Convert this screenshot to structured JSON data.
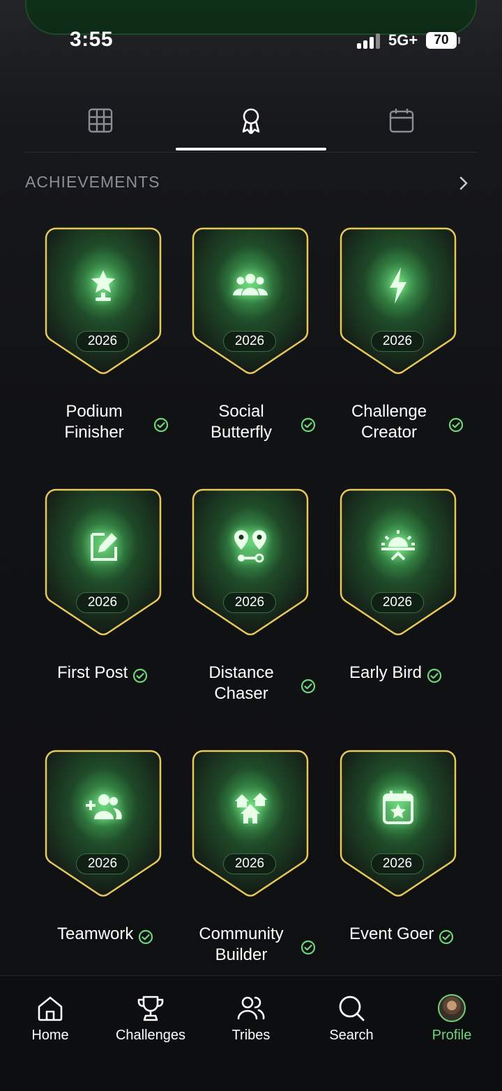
{
  "status_bar": {
    "time": "3:55",
    "network": "5G+",
    "battery": "70"
  },
  "tabs": [
    {
      "icon": "grid-icon"
    },
    {
      "icon": "ribbon-award-icon",
      "selected": true
    },
    {
      "icon": "calendar-icon"
    }
  ],
  "section": {
    "title": "ACHIEVEMENTS",
    "arrow_icon": "chevron-right-icon"
  },
  "achievements": [
    {
      "name": "Podium Finisher",
      "line1": "Podium",
      "line2": "Finisher",
      "year": "2026",
      "icon": "trophy-star-icon",
      "completed": true
    },
    {
      "name": "Social Butterfly",
      "line1": "Social",
      "line2": "Butterfly",
      "year": "2026",
      "icon": "group-icon",
      "completed": true
    },
    {
      "name": "Challenge Creator",
      "line1": "Challenge",
      "line2": "Creator",
      "year": "2026",
      "icon": "lightning-icon",
      "completed": true
    },
    {
      "name": "First Post",
      "line1": "First Post",
      "line2": "",
      "year": "2026",
      "icon": "edit-icon",
      "completed": true
    },
    {
      "name": "Distance Chaser",
      "line1": "Distance",
      "line2": "Chaser",
      "year": "2026",
      "icon": "route-pins-icon",
      "completed": true
    },
    {
      "name": "Early Bird",
      "line1": "Early Bird",
      "line2": "",
      "year": "2026",
      "icon": "sunrise-icon",
      "completed": true
    },
    {
      "name": "Teamwork",
      "line1": "Teamwork",
      "line2": "",
      "year": "2026",
      "icon": "add-group-icon",
      "completed": true
    },
    {
      "name": "Community Builder",
      "line1": "Community",
      "line2": "Builder",
      "year": "2026",
      "icon": "houses-icon",
      "completed": true
    },
    {
      "name": "Event Goer",
      "line1": "Event Goer",
      "line2": "",
      "year": "2026",
      "icon": "calendar-star-icon",
      "completed": true
    }
  ],
  "bottom_nav": [
    {
      "label": "Home",
      "icon": "home-icon"
    },
    {
      "label": "Challenges",
      "icon": "trophy-icon"
    },
    {
      "label": "Tribes",
      "icon": "people-icon"
    },
    {
      "label": "Search",
      "icon": "search-icon"
    },
    {
      "label": "Profile",
      "icon": "avatar",
      "active": true
    }
  ],
  "colors": {
    "accent_green": "#6fd47b",
    "badge_border": "#e7c85a",
    "background": "#111214"
  }
}
